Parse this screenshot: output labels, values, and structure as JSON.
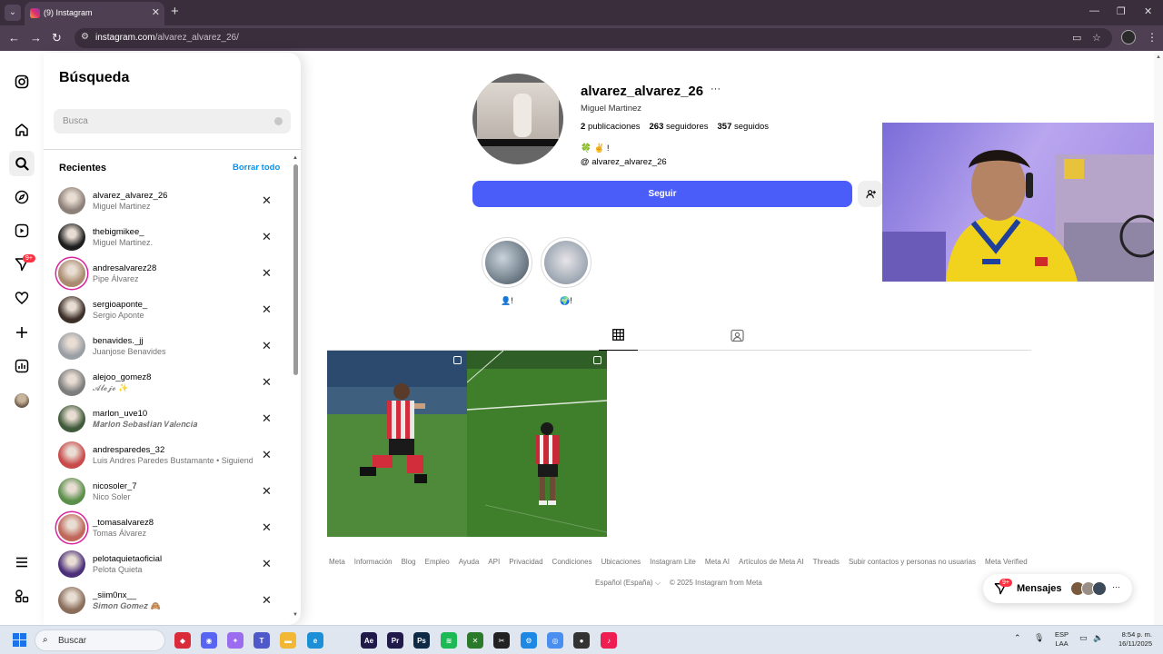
{
  "browser": {
    "tab_title": "(9) Instagram",
    "tab_close": "✕",
    "new_tab": "+",
    "url_host": "instagram.com",
    "url_path": "/alvarez_alvarez_26/",
    "window_controls": [
      "—",
      "❐",
      "✕"
    ]
  },
  "rail": {
    "notification_badge": "9+"
  },
  "search": {
    "title": "Búsqueda",
    "placeholder": "Busca",
    "recent_label": "Recientes",
    "clear_all": "Borrar todo",
    "recents": [
      {
        "username": "alvarez_alvarez_26",
        "name": "Miguel Martinez",
        "color": "#8d8079"
      },
      {
        "username": "thebigmikee_",
        "name": "Miguel Martinez.",
        "color": "#1e1e1e"
      },
      {
        "username": "andresalvarez28",
        "name": "Pipe Álvarez",
        "color": "#a98b6f"
      },
      {
        "username": "sergioaponte_",
        "name": "Sergio Aponte",
        "color": "#3b2f28"
      },
      {
        "username": "benavides._jj",
        "name": "Juanjose Benavides",
        "color": "#9a9fa6"
      },
      {
        "username": "alejoo_gomez8",
        "name": "𝓐𝓵𝓮𝓳𝓸 ✨",
        "color": "#7d7d7d"
      },
      {
        "username": "marlon_uve10",
        "name": "𝑴𝒂𝒓𝒍𝒐𝒏 𝑺𝒆𝒃𝒂𝒔𝒕𝒊𝒂𝒏 𝑽𝒂𝒍𝒆𝒏𝒄𝒊𝒂",
        "color": "#3f5a3a"
      },
      {
        "username": "andresparedes_32",
        "name": "Luis Andres Paredes Bustamante • Siguiendo",
        "color": "#c84a4a"
      },
      {
        "username": "nicosoler_7",
        "name": "Nico Soler",
        "color": "#5a8f4a"
      },
      {
        "username": "_tomasalvarez8",
        "name": "Tomas Álvarez",
        "color": "#c0665a"
      },
      {
        "username": "pelotaquietaoficial",
        "name": "Pelota Quieta",
        "color": "#4b2f7a"
      },
      {
        "username": "_siim0nx__",
        "name": "𝑺𝒊𝒎𝒐𝒏 𝑮𝒐𝒎𝒆𝒛 🙈",
        "color": "#8a6d5a"
      }
    ]
  },
  "profile": {
    "username": "alvarez_alvarez_26",
    "more": "···",
    "full_name": "Miguel Martinez",
    "posts_count": "2",
    "posts_label": "publicaciones",
    "followers_count": "263",
    "followers_label": "seguidores",
    "following_count": "357",
    "following_label": "seguidos",
    "bio_emoji": "🍀 ✌️ !",
    "threads_handle": "alvarez_alvarez_26",
    "follow_label": "Seguir",
    "highlights": [
      {
        "label": "👤!",
        "color": "#6f7f8a"
      },
      {
        "label": "🌍!",
        "color": "#8a9aa8"
      }
    ]
  },
  "footer": {
    "links": [
      "Meta",
      "Información",
      "Blog",
      "Empleo",
      "Ayuda",
      "API",
      "Privacidad",
      "Condiciones",
      "Ubicaciones",
      "Instagram Lite",
      "Meta AI",
      "Artículos de Meta AI",
      "Threads",
      "Subir contactos y personas no usuarias",
      "Meta Verified"
    ],
    "language": "Español (España) ⌵",
    "copyright": "© 2025 Instagram from Meta"
  },
  "messages": {
    "label": "Mensajes",
    "badge": "9+",
    "more": "···"
  },
  "taskbar": {
    "search_placeholder": "Buscar",
    "lang_line1": "ESP",
    "lang_line2": "LAA",
    "time": "8:54 p. m.",
    "date": "16/11/2025",
    "apps": [
      {
        "name": "app-red",
        "color": "#d92b3a",
        "glyph": "◆"
      },
      {
        "name": "discord",
        "color": "#5865f2",
        "glyph": "◉"
      },
      {
        "name": "copilot",
        "color": "#9b6cf0",
        "glyph": "✦"
      },
      {
        "name": "teams",
        "color": "#5059c9",
        "glyph": "T"
      },
      {
        "name": "explorer",
        "color": "#f2b735",
        "glyph": "▬"
      },
      {
        "name": "edge",
        "color": "#1c8fd6",
        "glyph": "e"
      },
      {
        "name": "after-effects",
        "color": "#1f1a4a",
        "glyph": "Ae"
      },
      {
        "name": "premiere",
        "color": "#1f1a4a",
        "glyph": "Pr"
      },
      {
        "name": "photoshop",
        "color": "#0f2a44",
        "glyph": "Ps"
      },
      {
        "name": "spotify",
        "color": "#1db954",
        "glyph": "≋"
      },
      {
        "name": "xbox",
        "color": "#2b7a2b",
        "glyph": "✕"
      },
      {
        "name": "capcut",
        "color": "#222222",
        "glyph": "✂"
      },
      {
        "name": "vscode-like",
        "color": "#1e88e5",
        "glyph": "⚙"
      },
      {
        "name": "chrome",
        "color": "#4a8ef0",
        "glyph": "◎"
      },
      {
        "name": "app-dark",
        "color": "#333333",
        "glyph": "●"
      },
      {
        "name": "tiktok",
        "color": "#ee1d52",
        "glyph": "♪"
      }
    ]
  }
}
